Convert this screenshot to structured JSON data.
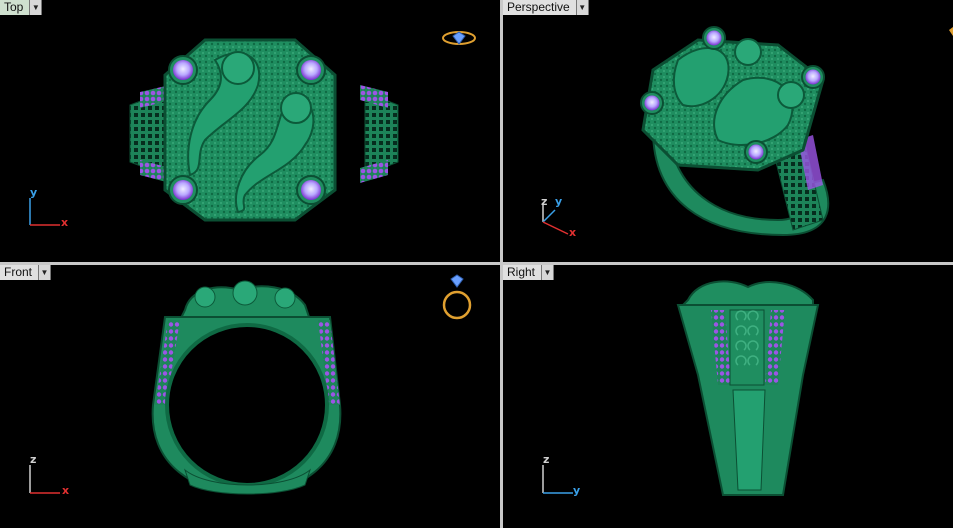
{
  "viewports": {
    "top": {
      "title": "Top",
      "axes": [
        "y",
        "x"
      ]
    },
    "persp": {
      "title": "Perspective",
      "axes": [
        "z",
        "y",
        "x"
      ]
    },
    "front": {
      "title": "Front",
      "axes": [
        "z",
        "x"
      ]
    },
    "right": {
      "title": "Right",
      "axes": [
        "z",
        "y"
      ]
    }
  },
  "colors": {
    "ring_green": "#1e8a5e",
    "ring_dark": "#0d5b3a",
    "gem_purple": "#8a3fd6",
    "gem_light": "#d9d3ff",
    "gold": "#e0a030",
    "axis_x": "#e03030",
    "axis_y": "#3aa0e8"
  },
  "icons": {
    "top_gizmo": "ring-top-gizmo-icon",
    "front_gizmo": "ring-front-gizmo-icon",
    "dropdown": "chevron-down-icon"
  }
}
